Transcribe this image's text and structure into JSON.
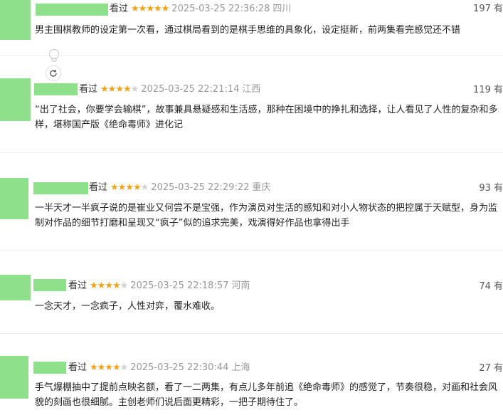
{
  "reviews": [
    {
      "status": "看过",
      "stars": 5,
      "time": "2025-03-25 22:36:28",
      "location": "四川",
      "votes": "197 有",
      "text": "男主围棋教师的设定第一次看，通过棋局看到的是棋手思维的具象化，设定挺新，前两集看完感觉还不错"
    },
    {
      "status": "看过",
      "stars": 4,
      "time": "2025-03-25 22:21:14",
      "location": "江西",
      "votes": "119 有",
      "text": "“出了社会，你要学会输棋”，故事兼具悬疑感和生活感，那种在困境中的挣扎和选择，让人看见了人性的复杂和多样，堪称国产版《绝命毒师》进化记"
    },
    {
      "status": "看过",
      "stars": 4,
      "time": "2025-03-25 22:29:22",
      "location": "重庆",
      "votes": "93 有",
      "text": "一半天才一半疯子说的是崔业又何尝不是宝强，作为演员对生活的感知和对小人物状态的把控属于天赋型，身为监制对作品的细节打磨和呈现又“疯子”似的追求完美，戏演得好作品也拿得出手"
    },
    {
      "status": "看过",
      "stars": 4,
      "time": "2025-03-25 22:18:57",
      "location": "河南",
      "votes": "74 有",
      "text": "一念天才，一念疯子，人性对弈，覆水难收。"
    },
    {
      "status": "看过",
      "stars": 4,
      "time": "2025-03-25 22:30:44",
      "location": "上海",
      "votes": "27 有",
      "text": "手气爆棚抽中了提前点映名额，看了一二两集，有点儿多年前追《绝命毒师》的感觉了，节奏很稳，对画和社会风貌的刻画也很细腻。主创老师们说后面更精彩，一把子期待住了。"
    }
  ],
  "colors": {
    "star_on": "#f0a31a",
    "star_off": "#d2d2d2",
    "mask": "#8ee08a"
  },
  "icons": {
    "bulb": "lightbulb-icon",
    "refresh": "refresh-icon"
  }
}
